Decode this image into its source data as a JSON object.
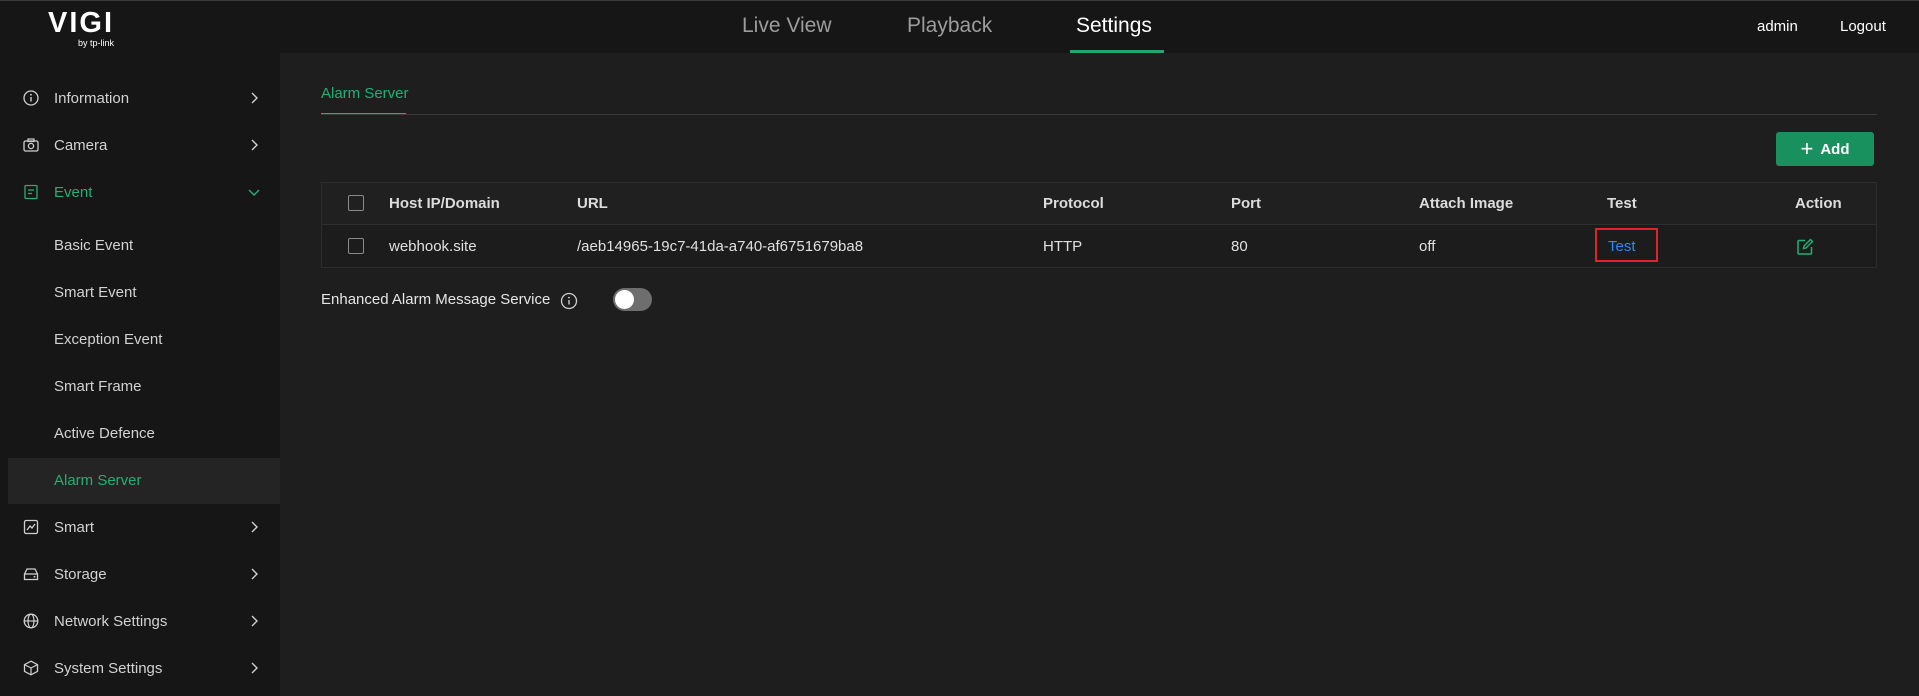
{
  "header": {
    "logo_text": "VIGI",
    "logo_sub": "by tp-link",
    "tabs": [
      {
        "label": "Live View",
        "active": false
      },
      {
        "label": "Playback",
        "active": false
      },
      {
        "label": "Settings",
        "active": true
      }
    ],
    "user": "admin",
    "logout": "Logout"
  },
  "sidebar": {
    "items": [
      {
        "label": "Information",
        "icon": "info-circle-icon",
        "expanded": false
      },
      {
        "label": "Camera",
        "icon": "camera-icon",
        "expanded": false
      },
      {
        "label": "Event",
        "icon": "event-doc-icon",
        "expanded": true
      },
      {
        "label": "Smart",
        "icon": "chart-icon",
        "expanded": false
      },
      {
        "label": "Storage",
        "icon": "storage-icon",
        "expanded": false
      },
      {
        "label": "Network Settings",
        "icon": "globe-icon",
        "expanded": false
      },
      {
        "label": "System Settings",
        "icon": "cube-icon",
        "expanded": false
      }
    ],
    "event_sub": [
      {
        "label": "Basic Event"
      },
      {
        "label": "Smart Event"
      },
      {
        "label": "Exception Event"
      },
      {
        "label": "Smart Frame"
      },
      {
        "label": "Active Defence"
      },
      {
        "label": "Alarm Server",
        "active": true
      }
    ]
  },
  "main": {
    "page_tab": "Alarm Server",
    "add_button": "Add",
    "table": {
      "columns": [
        "Host IP/Domain",
        "URL",
        "Protocol",
        "Port",
        "Attach Image",
        "Test",
        "Action"
      ],
      "rows": [
        {
          "host": "webhook.site",
          "url": "/aeb14965-19c7-41da-a740-af6751679ba8",
          "protocol": "HTTP",
          "port": "80",
          "attach_image": "off",
          "test": "Test"
        }
      ]
    },
    "enhanced_label": "Enhanced Alarm Message Service",
    "enhanced_enabled": false
  },
  "colors": {
    "accent": "#21b074",
    "add_button": "#19915f",
    "link": "#2d8cf0",
    "highlight_box": "#e0232a"
  }
}
